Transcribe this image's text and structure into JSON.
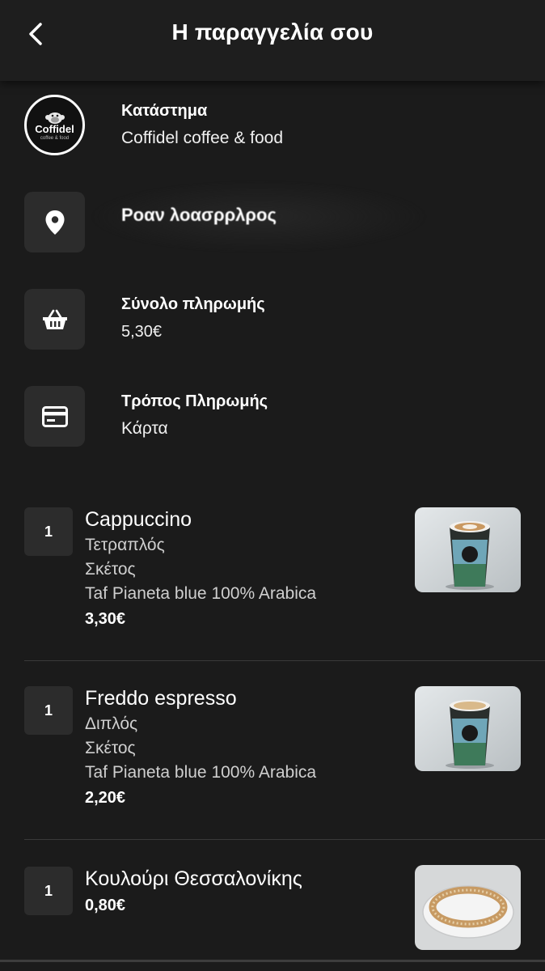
{
  "header": {
    "title": "Η παραγγελία σου"
  },
  "store": {
    "label": "Κατάστημα",
    "name": "Coffidel coffee & food",
    "logo_text": "Coffidel",
    "logo_sub": "coffee & food"
  },
  "address": {
    "value": "Ροαν λοασρρλρος"
  },
  "total": {
    "label": "Σύνολο πληρωμής",
    "value": "5,30€"
  },
  "payment": {
    "label": "Τρόπος Πληρωμής",
    "value": "Κάρτα"
  },
  "items": [
    {
      "qty": "1",
      "name": "Cappuccino",
      "options": [
        "Τετραπλός",
        "Σκέτος",
        "Taf Pianeta blue 100% Arabica"
      ],
      "price": "3,30€"
    },
    {
      "qty": "1",
      "name": "Freddo espresso",
      "options": [
        "Διπλός",
        "Σκέτος",
        "Taf Pianeta blue 100% Arabica"
      ],
      "price": "2,20€"
    },
    {
      "qty": "1",
      "name": "Κουλούρι Θεσσαλονίκης",
      "options": [],
      "price": "0,80€"
    }
  ],
  "icons": {
    "back": "chevron-left-icon",
    "location": "location-pin-icon",
    "basket": "basket-icon",
    "card": "credit-card-icon"
  },
  "colors": {
    "background": "#1b1b1b",
    "surface": "#2c2c2c",
    "text": "#ffffff"
  }
}
